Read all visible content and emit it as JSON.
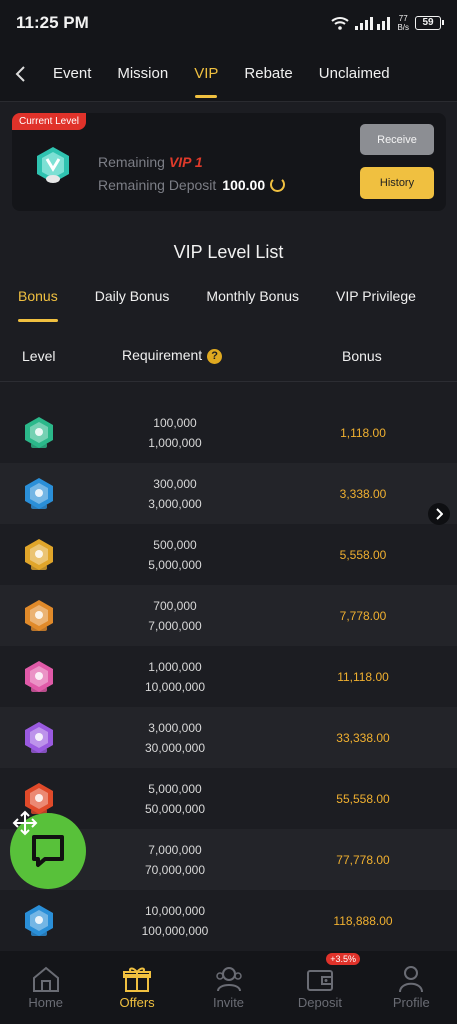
{
  "status_bar": {
    "time": "11:25 PM",
    "speed_top": "77",
    "speed_bottom": "B/s",
    "battery": "59"
  },
  "nav": {
    "back_icon": "chevron-left-icon",
    "tabs": [
      {
        "label": "Event"
      },
      {
        "label": "Mission"
      },
      {
        "label": "VIP",
        "active": true
      },
      {
        "label": "Rebate"
      },
      {
        "label": "Unclaimed"
      }
    ]
  },
  "level_card": {
    "badge": "Current Level",
    "remaining_label": "Remaining",
    "vip_level": "VIP 1",
    "deposit_label": "Remaining Deposit",
    "deposit_value": "100.00",
    "receive_label": "Receive",
    "history_label": "History"
  },
  "list_title": "VIP Level List",
  "sub_tabs": [
    {
      "label": "Bonus",
      "active": true
    },
    {
      "label": "Daily Bonus"
    },
    {
      "label": "Monthly Bonus"
    },
    {
      "label": "VIP Privilege"
    }
  ],
  "table": {
    "headers": {
      "level": "Level",
      "requirement": "Requirement",
      "bonus": "Bonus"
    },
    "rows": [
      {
        "badge_color": "#2bb88a",
        "req1": "100,000",
        "req2": "1,000,000",
        "bonus": "1,118.00"
      },
      {
        "badge_color": "#2a8fd8",
        "req1": "300,000",
        "req2": "3,000,000",
        "bonus": "3,338.00"
      },
      {
        "badge_color": "#e0a52a",
        "req1": "500,000",
        "req2": "5,000,000",
        "bonus": "5,558.00"
      },
      {
        "badge_color": "#e08a2a",
        "req1": "700,000",
        "req2": "7,000,000",
        "bonus": "7,778.00"
      },
      {
        "badge_color": "#e05aa8",
        "req1": "1,000,000",
        "req2": "10,000,000",
        "bonus": "11,118.00"
      },
      {
        "badge_color": "#9a5ae0",
        "req1": "3,000,000",
        "req2": "30,000,000",
        "bonus": "33,338.00"
      },
      {
        "badge_color": "#e04a2a",
        "req1": "5,000,000",
        "req2": "50,000,000",
        "bonus": "55,558.00"
      },
      {
        "badge_color": "#58c13a",
        "req1": "7,000,000",
        "req2": "70,000,000",
        "bonus": "77,778.00"
      },
      {
        "badge_color": "#2a8fd8",
        "req1": "10,000,000",
        "req2": "100,000,000",
        "bonus": "118,888.00"
      }
    ]
  },
  "bottom_nav": [
    {
      "label": "Home",
      "icon": "home-icon"
    },
    {
      "label": "Offers",
      "icon": "gift-icon",
      "active": true
    },
    {
      "label": "Invite",
      "icon": "invite-icon"
    },
    {
      "label": "Deposit",
      "icon": "wallet-icon",
      "promo": "+3.5%"
    },
    {
      "label": "Profile",
      "icon": "profile-icon"
    }
  ]
}
